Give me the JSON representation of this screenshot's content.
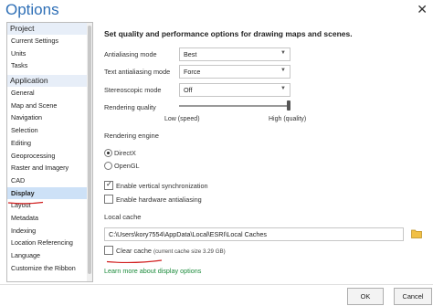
{
  "window": {
    "title": "Options",
    "close_glyph": "✕"
  },
  "sidebar": {
    "sections": [
      {
        "header": "Project",
        "items": [
          "Current Settings",
          "Units",
          "Tasks"
        ]
      },
      {
        "header": "Application",
        "items": [
          "General",
          "Map and Scene",
          "Navigation",
          "Selection",
          "Editing",
          "Geoprocessing",
          "Raster and Imagery",
          "CAD",
          "Display",
          "Layout",
          "Metadata",
          "Indexing",
          "Location Referencing",
          "Language",
          "Customize the Ribbon"
        ]
      }
    ],
    "selected": "Display"
  },
  "main": {
    "heading": "Set quality and performance options for drawing maps and scenes.",
    "antialiasing_label": "Antialiasing mode",
    "antialiasing_value": "Best",
    "text_antialiasing_label": "Text antialiasing mode",
    "text_antialiasing_value": "Force",
    "stereoscopic_label": "Stereoscopic mode",
    "stereoscopic_value": "Off",
    "rendering_quality_label": "Rendering quality",
    "rendering_quality_level": 1.0,
    "slider_low": "Low (speed)",
    "slider_high": "High (quality)",
    "rendering_engine_title": "Rendering engine",
    "engines": [
      {
        "label": "DirectX",
        "checked": true
      },
      {
        "label": "OpenGL",
        "checked": false
      }
    ],
    "vsync_label": "Enable vertical synchronization",
    "vsync_checked": true,
    "hw_antialias_label": "Enable hardware antialiasing",
    "hw_antialias_checked": false,
    "local_cache_title": "Local cache",
    "cache_path": "C:\\Users\\kory7554\\AppData\\Local\\ESRI\\Local Caches",
    "clear_cache_label": "Clear cache",
    "cache_size_text": "(current cache size 3.29 GB)",
    "clear_cache_checked": false,
    "learn_more": "Learn more about display options"
  },
  "footer": {
    "ok": "OK",
    "cancel": "Cancel"
  },
  "colors": {
    "title": "#2e6fb6",
    "section_bg": "#e7eef8",
    "selected_bg": "#cde1f7",
    "link": "#1a8a3a",
    "annotation": "#d11f1f"
  },
  "icons": [
    "close-icon",
    "chevron-down-icon",
    "folder-icon",
    "checkmark-icon"
  ]
}
